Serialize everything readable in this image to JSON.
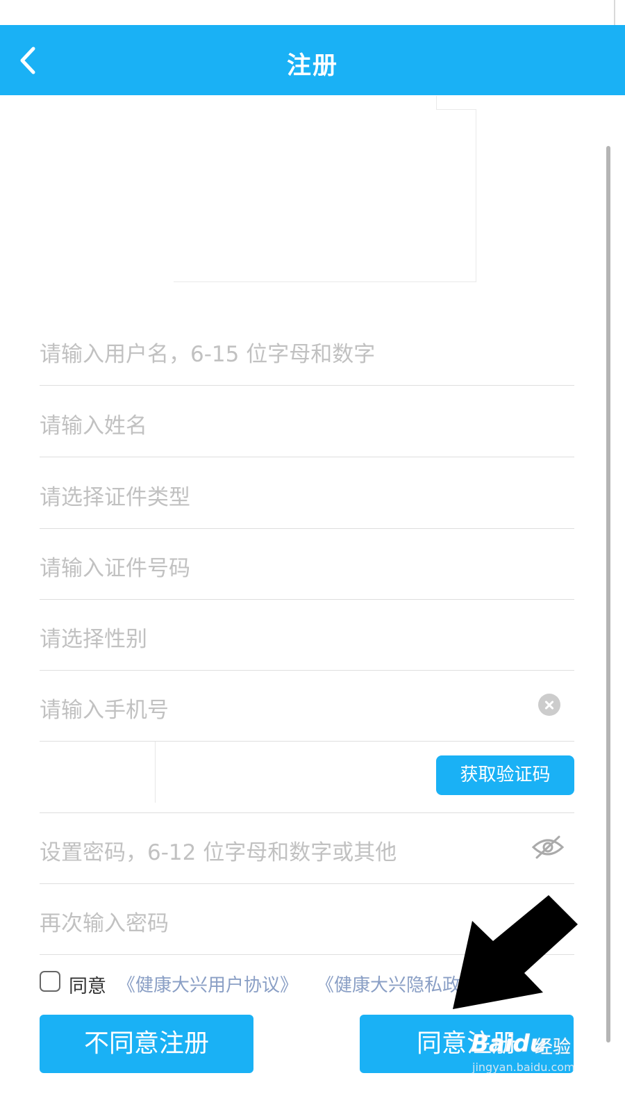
{
  "navbar": {
    "title": "注册",
    "back_icon": "chevron-left-icon",
    "background": "#1ab1f5"
  },
  "form": {
    "username_placeholder": "请输入用户名，6-15 位字母和数字",
    "name_placeholder": "请输入姓名",
    "id_type_placeholder": "请选择证件类型",
    "id_number_placeholder": "请输入证件号码",
    "gender_placeholder": "请选择性别",
    "phone_placeholder": "请输入手机号",
    "get_code_label": "获取验证码",
    "password_placeholder": "设置密码，6-12 位字母和数字或其他",
    "confirm_password_placeholder": "再次输入密码"
  },
  "agreement": {
    "checked": false,
    "label": "同意",
    "user_agreement_link": "《健康大兴用户协议》",
    "privacy_link": "《健康大兴隐私政"
  },
  "buttons": {
    "disagree_label": "不同意注册",
    "agree_label": "同意注册"
  },
  "watermark": {
    "brand": "Baidu",
    "text": "经验",
    "url": "jingyan.baidu.com"
  },
  "colors": {
    "accent": "#1ab1f5",
    "placeholder": "#c1c1c1",
    "link": "#8a9fc5"
  }
}
